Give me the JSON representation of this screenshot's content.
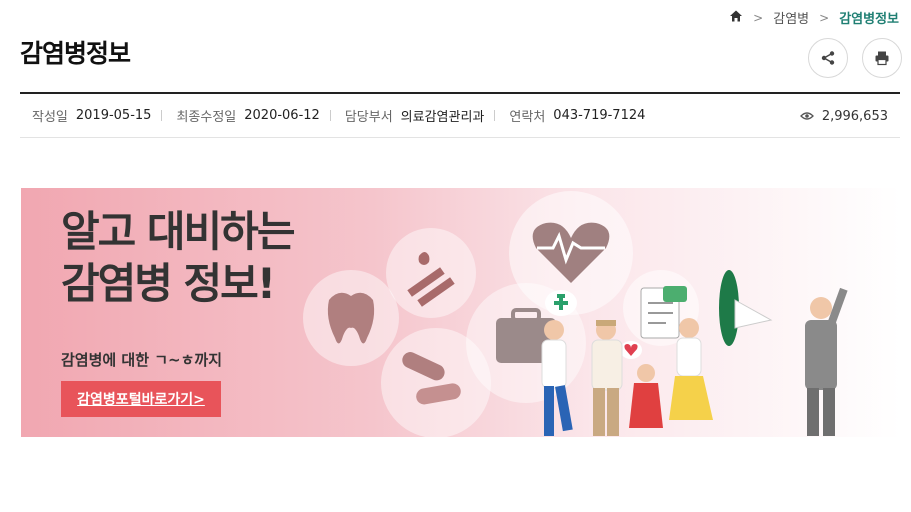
{
  "breadcrumb": {
    "items": [
      "감염병",
      "감염병정보"
    ],
    "separator": ">"
  },
  "page": {
    "title": "감염병정보"
  },
  "toolbar": {
    "share_icon": "share-icon",
    "print_icon": "print-icon"
  },
  "meta": {
    "created_label": "작성일",
    "created_value": "2019-05-15",
    "modified_label": "최종수정일",
    "modified_value": "2020-06-12",
    "dept_label": "담당부서",
    "dept_value": "의료감염관리과",
    "contact_label": "연락처",
    "contact_value": "043-719-7124",
    "views": "2,996,653"
  },
  "banner": {
    "headline_1": "알고 대비하는",
    "headline_2": "감염병 정보!",
    "subline": "감염병에 대한 ㄱ~ㅎ까지",
    "button_label": "감염병포털바로가기>"
  },
  "colors": {
    "accent": "#1f7f73",
    "button": "#e8545a",
    "banner_start": "#f1a7b1"
  }
}
